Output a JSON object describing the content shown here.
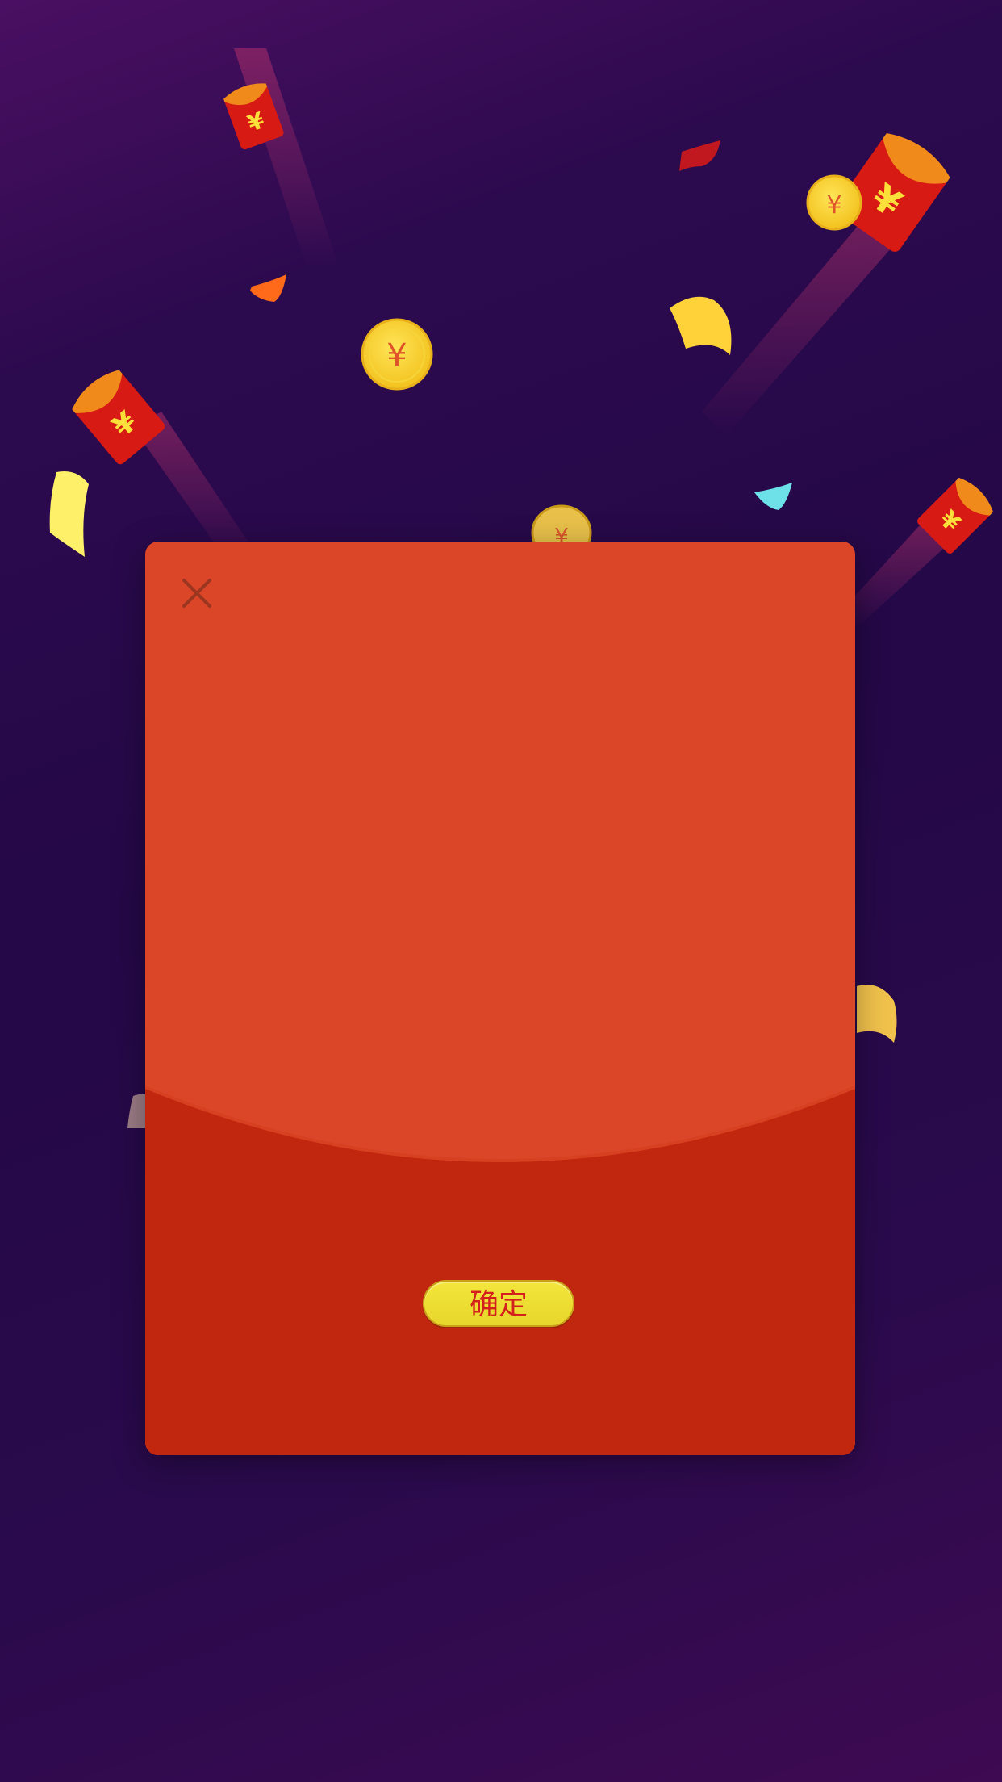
{
  "dialog": {
    "confirm_label": "确定",
    "close_icon": "close-icon"
  },
  "decorations": {
    "coin_symbol": "¥",
    "envelope_symbol": "¥"
  },
  "colors": {
    "background_dark": "#240847",
    "modal_top": "#dc4628",
    "modal_bottom": "#c0270e",
    "button_yellow": "#f0e032",
    "button_text": "#d3201d"
  }
}
